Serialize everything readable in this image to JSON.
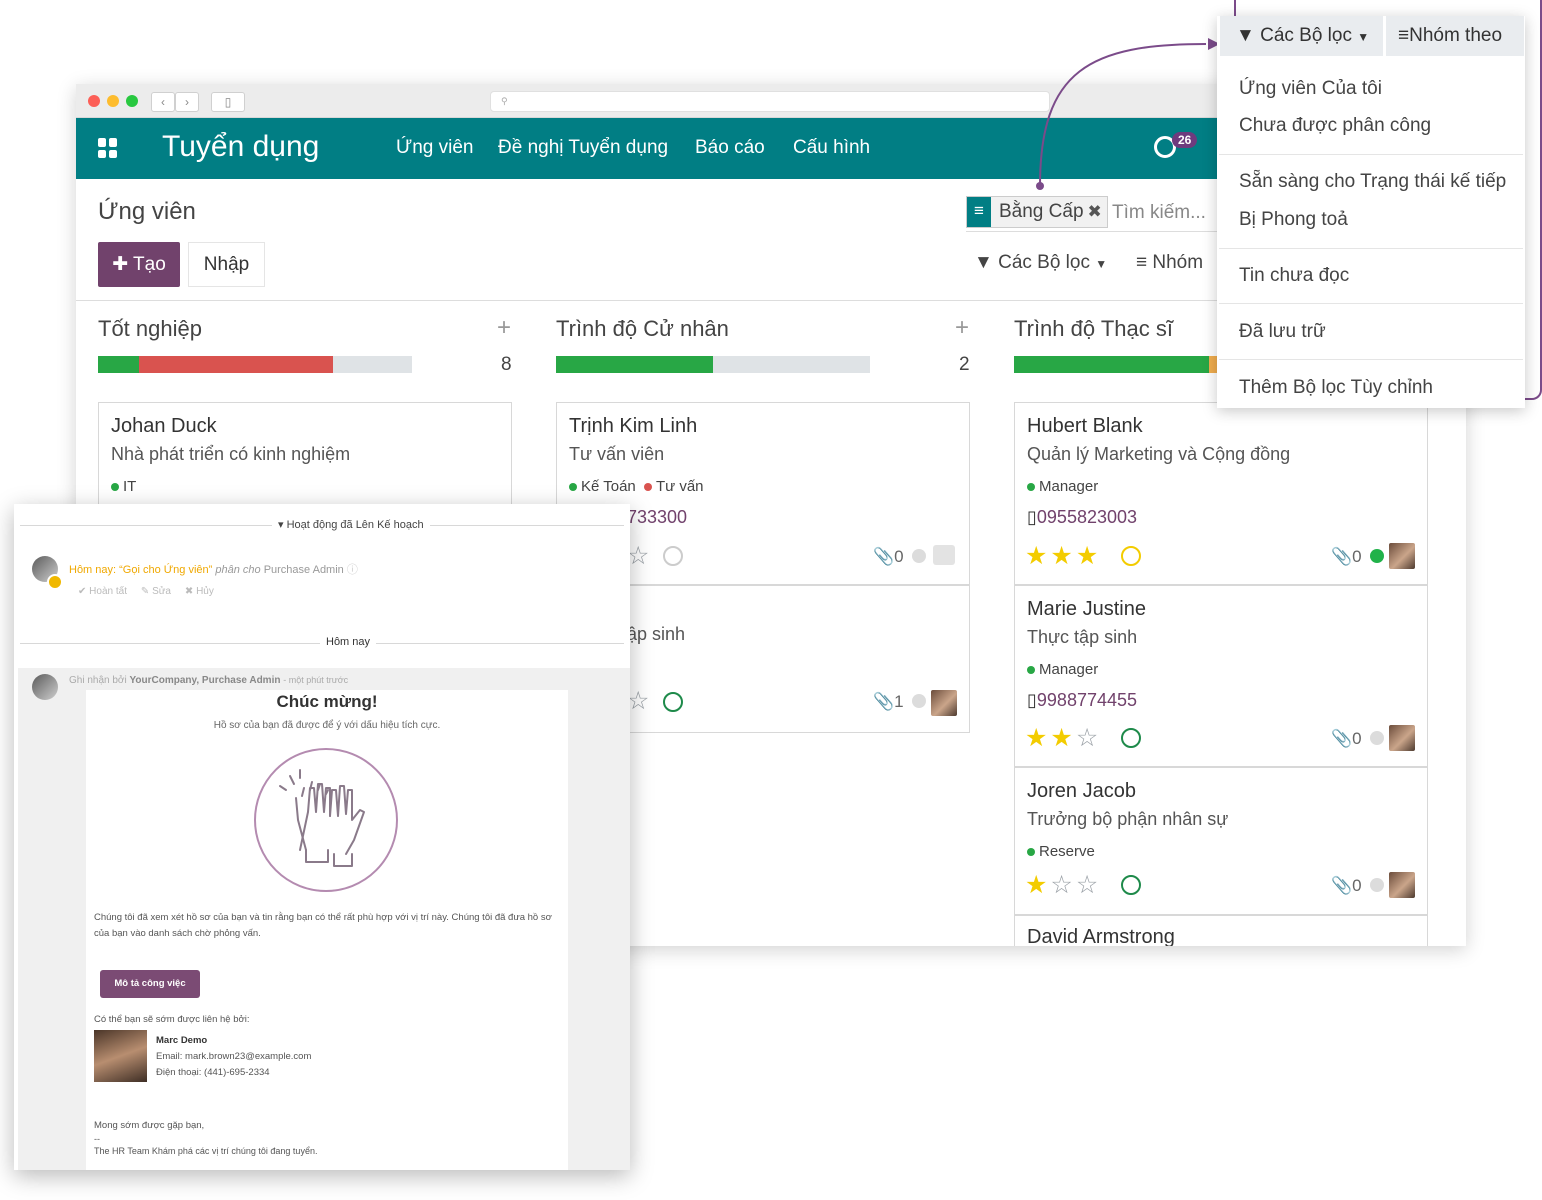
{
  "navbar": {
    "app_title": "Tuyển dụng",
    "menu": [
      "Ứng viên",
      "Đề nghị Tuyển dụng",
      "Báo cáo",
      "Cấu hình"
    ],
    "activity_count": "26",
    "color": "#017e84"
  },
  "browser": {
    "url_placeholder": ""
  },
  "control_panel": {
    "title": "Ứng viên",
    "create_label": "Tạo",
    "import_label": "Nhập",
    "facet_label": "Bằng Cấp",
    "search_placeholder": "Tìm kiếm...",
    "filters_label": "Các Bộ lọc",
    "groupby_label": "Nhóm"
  },
  "columns": [
    {
      "title": "Tốt nghiệp",
      "count": "8",
      "progress": [
        {
          "color": "#28a745",
          "fraction": 0.13
        },
        {
          "color": "#d9534f",
          "fraction": 0.62
        }
      ],
      "cards": [
        {
          "name": "Johan Duck",
          "job": "Nhà phát triển có kinh nghiệm",
          "tags": [
            {
              "label": "IT",
              "color": "#28a745"
            }
          ]
        }
      ]
    },
    {
      "title": "Trình độ Cử nhân",
      "count": "2",
      "progress": [
        {
          "color": "#28a745",
          "fraction": 0.5
        }
      ],
      "cards": [
        {
          "name": "Trịnh Kim Linh",
          "job": "Tư vấn viên",
          "tags": [
            {
              "label": "Kế Toán",
              "color": "#28a745"
            },
            {
              "label": "Tư vấn",
              "color": "#d9534f"
            }
          ],
          "phone": "733300",
          "attachments": "0"
        },
        {
          "job": "ập sinh",
          "attachments": "1"
        }
      ]
    },
    {
      "title": "Trình độ Thạc sĩ",
      "progress": [
        {
          "color": "#28a745",
          "fraction": 0.62
        },
        {
          "color": "#f0ad4e",
          "fraction": 0.03
        }
      ],
      "cards": [
        {
          "name": "Hubert Blank",
          "job": "Quản lý Marketing và Cộng đồng",
          "tags": [
            {
              "label": "Manager",
              "color": "#28a745"
            }
          ],
          "phone": "0955823003",
          "stars": 3,
          "attachments": "0"
        },
        {
          "name": "Marie Justine",
          "job": "Thực tập sinh",
          "tags": [
            {
              "label": "Manager",
              "color": "#28a745"
            }
          ],
          "phone": "9988774455",
          "stars": 2,
          "attachments": "0"
        },
        {
          "name": "Joren Jacob",
          "job": "Trưởng bộ phận nhân sự",
          "tags": [
            {
              "label": "Reserve",
              "color": "#28a745"
            }
          ],
          "stars": 1,
          "attachments": "0"
        },
        {
          "name": "David Armstrong"
        }
      ]
    }
  ],
  "dropdown": {
    "filters_label": "Các Bộ lọc",
    "groupby_label": "Nhóm theo",
    "items": [
      "Ứng viên Của tôi",
      "Chưa được phân công",
      "Sẵn sàng cho Trạng thái kế tiếp",
      "Bị Phong toả",
      "Tin chưa đọc",
      "Đã lưu trữ",
      "Thêm Bộ lọc Tùy chỉnh"
    ],
    "accent": "#7b4b8a"
  },
  "chatter": {
    "planned_label": "Hoạt động đã Lên Kế hoạch",
    "activity_today": "Hôm nay:",
    "activity_summary": "“Gọi cho Ứng viên”",
    "activity_assigned": "phân cho",
    "activity_user": "Purchase Admin",
    "action_done": "Hoàn tất",
    "action_edit": "Sửa",
    "action_cancel": "Hủy",
    "today_label": "Hôm nay",
    "msg_prefix": "Ghi nhận bởi",
    "msg_author": "YourCompany, Purchase Admin",
    "msg_time": "- một phút trước",
    "congrats": "Chúc mừng!",
    "congrats_sub": "Hồ sơ của bạn đã được để ý với dấu hiệu tích cực.",
    "paragraph": "Chúng tôi đã xem xét hồ sơ của bạn và tin rằng bạn có thể rất phù hợp với vị trí này. Chúng tôi đã đưa hồ sơ của bạn vào danh sách chờ phỏng vấn.",
    "job_button": "Mô tả công việc",
    "contact_label": "Có thể bạn sẽ sớm được liên hệ bởi:",
    "contact_name": "Marc Demo",
    "contact_email": "Email: mark.brown23@example.com",
    "contact_phone": "Điện thoại: (441)-695-2334",
    "closing": "Mong sớm được gặp bạn,",
    "dash": "--",
    "signature": "The HR Team Khám phá các vị trí chúng tôi đang tuyển."
  }
}
